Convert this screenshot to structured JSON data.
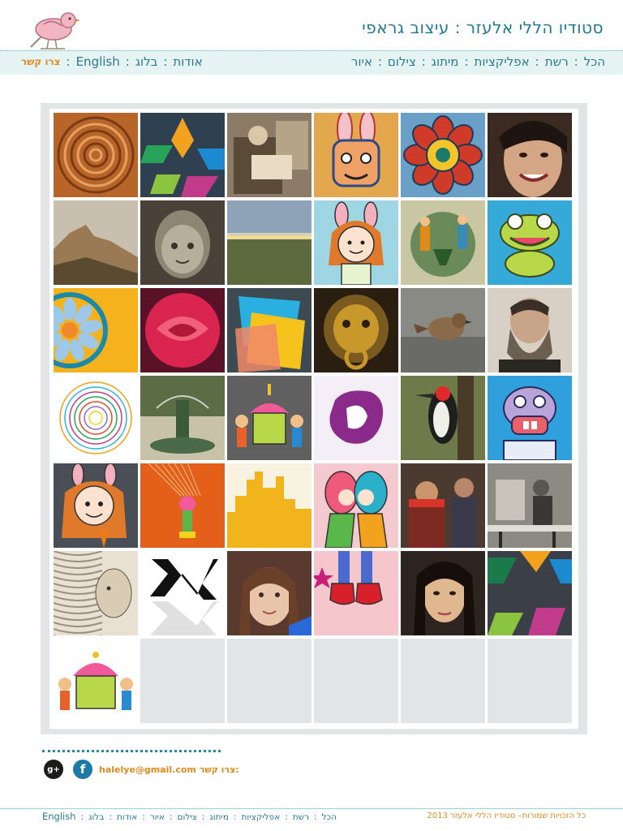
{
  "header": {
    "title": "סטודיו הללי אלעזר : עיצוב גראפי",
    "logo_icon": "bird-icon"
  },
  "nav": {
    "main_items": [
      "הכל",
      "רשת",
      "אפליקציות",
      "מיתוג",
      "צילום",
      "איור"
    ],
    "secondary_items": [
      "אודות",
      "בלוג",
      "English"
    ],
    "contact_label": "צרו קשר",
    "separator": ":"
  },
  "gallery": {
    "columns": 6,
    "tiles": [
      {
        "id": "tile-1",
        "label": "tree-rings",
        "color": "#b8652a"
      },
      {
        "id": "tile-2",
        "label": "geometric-logo",
        "color": "#2f4050"
      },
      {
        "id": "tile-3",
        "label": "vintage-photo",
        "color": "#8c7b66"
      },
      {
        "id": "tile-4",
        "label": "bunny-illustration",
        "color": "#e3a84e"
      },
      {
        "id": "tile-5",
        "label": "folk-flower",
        "color": "#cf3b28"
      },
      {
        "id": "tile-6",
        "label": "smiling-woman-portrait",
        "color": "#d5a685"
      },
      {
        "id": "tile-7",
        "label": "cliff-landscape",
        "color": "#9a7a55"
      },
      {
        "id": "tile-8",
        "label": "stone-cherub",
        "color": "#8f8575"
      },
      {
        "id": "tile-9",
        "label": "field-landscape",
        "color": "#5c6a3d"
      },
      {
        "id": "tile-10",
        "label": "bunny-girl",
        "color": "#9fd6e4"
      },
      {
        "id": "tile-11",
        "label": "dancing-couple",
        "color": "#c9c7a3"
      },
      {
        "id": "tile-12",
        "label": "frog-illustration",
        "color": "#35a9d8"
      },
      {
        "id": "tile-13",
        "label": "orange-mandala",
        "color": "#f6b21c"
      },
      {
        "id": "tile-14",
        "label": "red-rose",
        "color": "#d8244f"
      },
      {
        "id": "tile-15",
        "label": "abstract-shapes",
        "color": "#3e4a52"
      },
      {
        "id": "tile-16",
        "label": "golden-lion-knocker",
        "color": "#7a5a1f"
      },
      {
        "id": "tile-17",
        "label": "sparrow",
        "color": "#8a8a84"
      },
      {
        "id": "tile-18",
        "label": "bearded-man-portrait",
        "color": "#6b5f52"
      },
      {
        "id": "tile-19",
        "label": "rainbow-circles",
        "color": "#ffffff"
      },
      {
        "id": "tile-20",
        "label": "fountain",
        "color": "#5b6d44"
      },
      {
        "id": "tile-21",
        "label": "cupcake-kids",
        "color": "#606060"
      },
      {
        "id": "tile-22",
        "label": "purple-logo",
        "color": "#f4eff6"
      },
      {
        "id": "tile-23",
        "label": "woodpecker",
        "color": "#6f7a4a"
      },
      {
        "id": "tile-24",
        "label": "hippo-character",
        "color": "#2fa0dc"
      },
      {
        "id": "tile-25",
        "label": "carrot-girl",
        "color": "#4a4f57"
      },
      {
        "id": "tile-26",
        "label": "hanging-figure",
        "color": "#e45f1a"
      },
      {
        "id": "tile-27",
        "label": "yellow-city",
        "color": "#f7f3e0"
      },
      {
        "id": "tile-28",
        "label": "kissing-dolls",
        "color": "#f4c9cf"
      },
      {
        "id": "tile-29",
        "label": "cafe-scene",
        "color": "#7c2a22"
      },
      {
        "id": "tile-30",
        "label": "bw-cafe-photo",
        "color": "#8d8a84"
      },
      {
        "id": "tile-31",
        "label": "engraving-portrait",
        "color": "#9a9080"
      },
      {
        "id": "tile-32",
        "label": "hebrew-letter-logo",
        "color": "#ffffff"
      },
      {
        "id": "tile-33",
        "label": "girl-portrait",
        "color": "#5a3a2e"
      },
      {
        "id": "tile-34",
        "label": "red-shoes",
        "color": "#f5c6cc"
      },
      {
        "id": "tile-35",
        "label": "asian-woman-portrait",
        "color": "#2d2420"
      },
      {
        "id": "tile-36",
        "label": "geometric-logo-2",
        "color": "#3a3f48"
      },
      {
        "id": "tile-37",
        "label": "cupcake-kids-2",
        "color": "#ffffff"
      },
      {
        "id": "tile-38",
        "label": "empty",
        "color": "#e2e5e7"
      },
      {
        "id": "tile-39",
        "label": "empty",
        "color": "#e2e5e7"
      },
      {
        "id": "tile-40",
        "label": "empty",
        "color": "#e2e5e7"
      },
      {
        "id": "tile-41",
        "label": "empty",
        "color": "#e2e5e7"
      },
      {
        "id": "tile-42",
        "label": "empty",
        "color": "#e2e5e7"
      }
    ]
  },
  "contact": {
    "label": "צרו קשר:",
    "email": "halelye@gmail.com",
    "social_icons": [
      "gplus-icon",
      "facebook-icon"
    ],
    "gplus_text": "g+",
    "facebook_text": "f"
  },
  "footer": {
    "copyright": "כל הזכויות שמורות– סטודיו הללי אלעזר 2013",
    "nav_items": [
      "הכל",
      "רשת",
      "אפליקציות",
      "מיתוג",
      "צילום",
      "איור",
      "אודות",
      "בלוג",
      "English"
    ]
  },
  "colors": {
    "accent": "#1f7a93",
    "orange": "#e08a1e",
    "nav_bg": "#e6f3f3",
    "frame": "#e1e5e6"
  }
}
